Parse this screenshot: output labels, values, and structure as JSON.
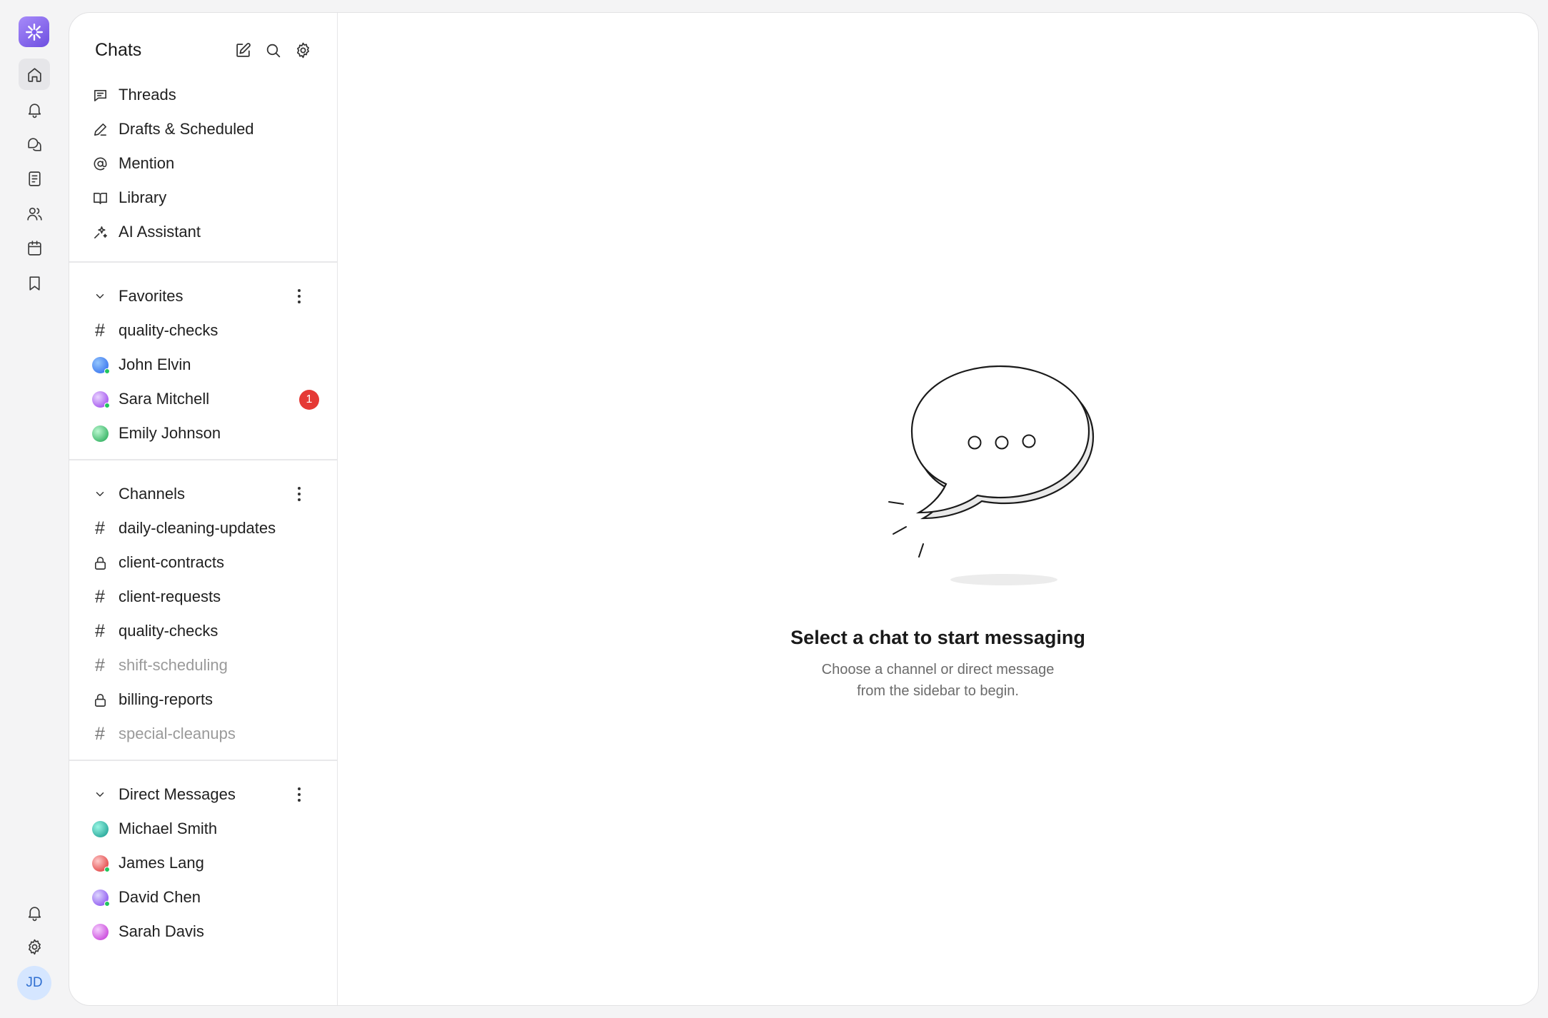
{
  "rail": {
    "user_initials": "JD",
    "logo_color": "#7c5cf0"
  },
  "sidebar": {
    "title": "Chats",
    "nav": [
      {
        "label": "Threads",
        "icon": "message-square-icon"
      },
      {
        "label": "Drafts & Scheduled",
        "icon": "pen-icon"
      },
      {
        "label": "Mention",
        "icon": "at-sign-icon"
      },
      {
        "label": "Library",
        "icon": "book-open-icon"
      },
      {
        "label": "AI Assistant",
        "icon": "sparkles-icon"
      }
    ],
    "favorites": {
      "title": "Favorites",
      "items": [
        {
          "label": "quality-checks",
          "type": "channel"
        },
        {
          "label": "John Elvin",
          "type": "dm",
          "color": "#3b82f6",
          "online": true
        },
        {
          "label": "Sara Mitchell",
          "type": "dm",
          "color": "#a855f7",
          "online": true,
          "unread": "1"
        },
        {
          "label": "Emily Johnson",
          "type": "dm",
          "color": "#22c55e",
          "online": false
        }
      ]
    },
    "channels": {
      "title": "Channels",
      "items": [
        {
          "label": "daily-cleaning-updates",
          "type": "public"
        },
        {
          "label": "client-contracts",
          "type": "private"
        },
        {
          "label": "client-requests",
          "type": "public"
        },
        {
          "label": "quality-checks",
          "type": "public"
        },
        {
          "label": "shift-scheduling",
          "type": "public",
          "muted": true
        },
        {
          "label": "billing-reports",
          "type": "private"
        },
        {
          "label": "special-cleanups",
          "type": "public",
          "muted": true
        }
      ]
    },
    "direct_messages": {
      "title": "Direct Messages",
      "items": [
        {
          "label": "Michael Smith",
          "color": "#14b8a6",
          "online": false
        },
        {
          "label": "James Lang",
          "color": "#ef4444",
          "online": true
        },
        {
          "label": "David Chen",
          "color": "#8b5cf6",
          "online": true
        },
        {
          "label": "Sarah Davis",
          "color": "#d946ef",
          "online": false
        }
      ]
    }
  },
  "empty_state": {
    "title": "Select a chat to start messaging",
    "subtitle_line1": "Choose a channel or direct message",
    "subtitle_line2": "from the sidebar to begin."
  },
  "colors": {
    "badge": "#e53935",
    "presence": "#22c55e",
    "avatar_bg": "#d5e6ff"
  }
}
